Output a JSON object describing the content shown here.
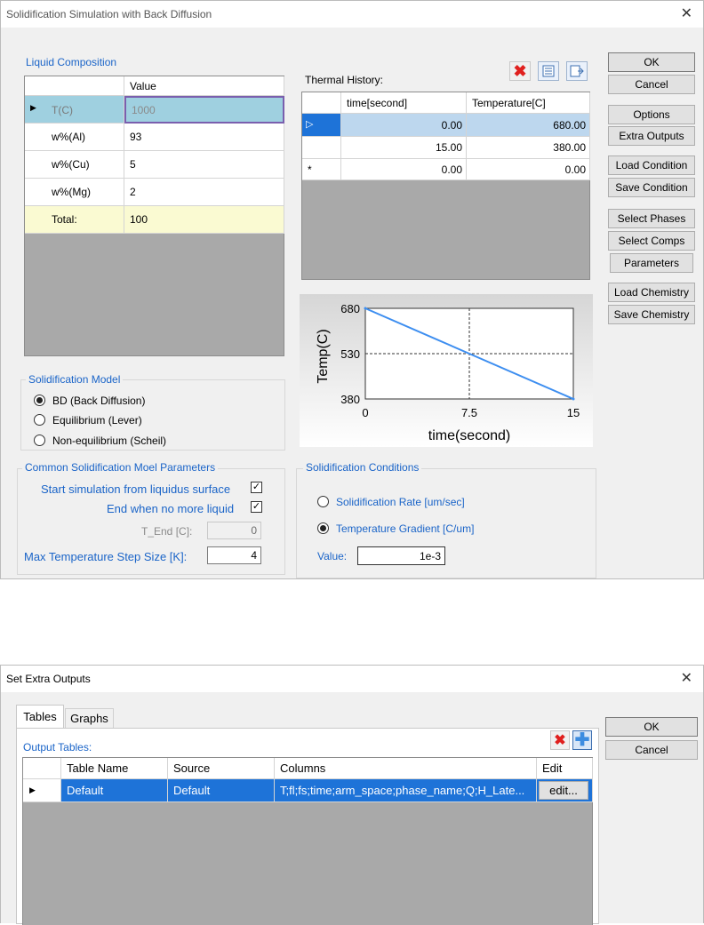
{
  "main_dialog": {
    "title": "Solidification Simulation with Back Diffusion",
    "liquid_composition": {
      "label": "Liquid Composition",
      "value_header": "Value",
      "rows": [
        {
          "name": "T(C)",
          "value": "1000"
        },
        {
          "name": "w%(Al)",
          "value": "93"
        },
        {
          "name": "w%(Cu)",
          "value": "5"
        },
        {
          "name": "w%(Mg)",
          "value": "2"
        },
        {
          "name": "Total:",
          "value": "100"
        }
      ]
    },
    "thermal_history": {
      "label": "Thermal History:",
      "headers": [
        "time[second]",
        "Temperature[C]"
      ],
      "rows": [
        {
          "time": "0.00",
          "temp": "680.00"
        },
        {
          "time": "15.00",
          "temp": "380.00"
        },
        {
          "marker": "*",
          "time": "0.00",
          "temp": "0.00"
        }
      ]
    },
    "buttons": {
      "ok": "OK",
      "cancel": "Cancel",
      "options": "Options",
      "extra_outputs": "Extra Outputs",
      "load_condition": "Load Condition",
      "save_condition": "Save Condition",
      "select_phases": "Select Phases",
      "select_comps": "Select Comps",
      "parameters": "Parameters",
      "load_chemistry": "Load Chemistry",
      "save_chemistry": "Save Chemistry"
    },
    "solidification_model": {
      "label": "Solidification Model",
      "options": [
        "BD (Back Diffusion)",
        "Equilibrium (Lever)",
        "Non-equilibrium (Scheil)"
      ],
      "selected_index": 0
    },
    "common_params": {
      "label": "Common Solidification Moel Parameters",
      "start_from_liquidus": "Start simulation from liquidus surface",
      "end_no_liquid": "End when no more liquid",
      "t_end_label": "T_End [C]:",
      "t_end_value": "0",
      "max_step_label": "Max Temperature Step Size [K]:",
      "max_step_value": "4"
    },
    "solidification_conditions": {
      "label": "Solidification Conditions",
      "rate_label": "Solidification Rate [um/sec]",
      "gradient_label": "Temperature Gradient [C/um]",
      "selected": "gradient",
      "value_label": "Value:",
      "value": "1e-3"
    }
  },
  "chart_data": {
    "type": "line",
    "x": [
      0,
      15
    ],
    "y": [
      680,
      380
    ],
    "xlabel": "time(second)",
    "ylabel": "Temp(C)",
    "xticks": [
      "0",
      "7.5",
      "15"
    ],
    "yticks": [
      "680",
      "530",
      "380"
    ],
    "xlim": [
      0,
      15
    ],
    "ylim": [
      380,
      680
    ],
    "line_color": "#3d8ef0"
  },
  "extra_dialog": {
    "title": "Set Extra Outputs",
    "tabs": [
      "Tables",
      "Graphs"
    ],
    "output_tables_label": "Output Tables:",
    "headers": [
      "Table Name",
      "Source",
      "Columns",
      "Edit"
    ],
    "rows": [
      {
        "name": "Default",
        "source": "Default",
        "columns": "T;fl;fs;time;arm_space;phase_name;Q;H_Late...",
        "edit": "edit..."
      }
    ],
    "ok": "OK",
    "cancel": "Cancel"
  }
}
